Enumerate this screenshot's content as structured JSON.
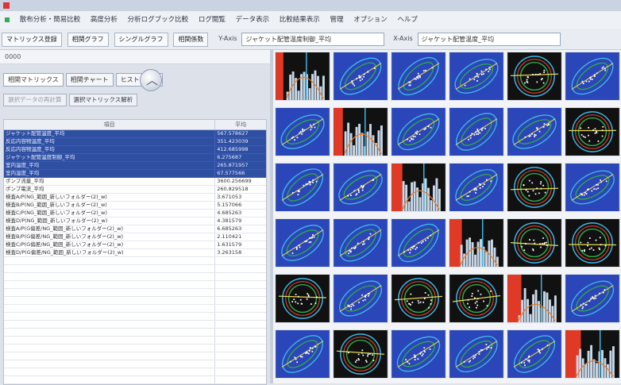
{
  "menu": {
    "items": [
      "散布分析・簡易比較",
      "高度分析",
      "分析ログブック比較",
      "ログ閲覧",
      "データ表示",
      "比較結果表示",
      "管理",
      "オプション",
      "ヘルプ"
    ]
  },
  "toolbar": {
    "tabs": [
      "マトリックス登録",
      "相関グラフ",
      "シングルグラフ",
      "相関係数"
    ],
    "yaxis_label": "Y-Axis",
    "yaxis_value": "ジャケット配管温度制御_平均",
    "xaxis_label": "X-Axis",
    "xaxis_value": "ジャケット配管温度_平均"
  },
  "subbar": {
    "text": "0000"
  },
  "left_tabs": [
    "相関マトリックス",
    "相関チャート",
    "ヒストグラム"
  ],
  "left_buttons": [
    "選択データの再計算",
    "選択マトリックス解析"
  ],
  "table": {
    "headers": [
      "項目",
      "平均"
    ],
    "rows": [
      {
        "name": "ジャケット配管温度_平均",
        "value": "567.578627",
        "selected": true
      },
      {
        "name": "反応内容物温度_平均",
        "value": "351.423039",
        "selected": true
      },
      {
        "name": "反応内容物温度_平均",
        "value": "412.685998",
        "selected": true
      },
      {
        "name": "ジャケット配管温度制御_平均",
        "value": "6.275687",
        "selected": true
      },
      {
        "name": "室内温度_平均",
        "value": "265.871957",
        "selected": true
      },
      {
        "name": "室内湿度_平均",
        "value": "67.577566",
        "selected": true
      },
      {
        "name": "ポンプ流量_平均",
        "value": "3600.256699",
        "selected": false
      },
      {
        "name": "ポンプ電流_平均",
        "value": "260.829518",
        "selected": false
      },
      {
        "name": "検査A/P(NG_範囲_新しいフォルダー(2)_w)",
        "value": "3.671053",
        "selected": false
      },
      {
        "name": "検査B/P(NG_範囲_新しいフォルダー(2)_w)",
        "value": "5.157066",
        "selected": false
      },
      {
        "name": "検査C/P(NG_範囲_新しいフォルダー(2)_w)",
        "value": "4.685263",
        "selected": false
      },
      {
        "name": "検査D/P(NG_範囲_新しいフォルダー(2)_w)",
        "value": "4.381579",
        "selected": false
      },
      {
        "name": "検査A/P(G偏差/NG_範囲_新しいフォルダー(2)_w)",
        "value": "6.685263",
        "selected": false
      },
      {
        "name": "検査B/P(G偏差/NG_範囲_新しいフォルダー(2)_w)",
        "value": "2.110421",
        "selected": false
      },
      {
        "name": "検査C/P(G偏差/NG_範囲_新しいフォルダー(2)_w)",
        "value": "1.631579",
        "selected": false
      },
      {
        "name": "検査D/P(G偏差/NG_範囲_新しいフォルダー(2)_w)",
        "value": "3.263158",
        "selected": false
      }
    ]
  },
  "matrix": {
    "rows": 6,
    "cols": 6,
    "cells": [
      [
        "histogram",
        "scatter-blue",
        "scatter-blue",
        "scatter-blue",
        "scatter-black",
        "scatter-blue"
      ],
      [
        "scatter-blue",
        "histogram",
        "scatter-blue",
        "scatter-blue",
        "scatter-blue",
        "scatter-black"
      ],
      [
        "scatter-blue",
        "scatter-blue",
        "histogram",
        "scatter-blue",
        "scatter-black",
        "scatter-blue"
      ],
      [
        "scatter-blue",
        "scatter-blue",
        "scatter-blue",
        "histogram",
        "scatter-black",
        "scatter-black"
      ],
      [
        "scatter-black",
        "scatter-blue",
        "scatter-black",
        "scatter-black",
        "histogram",
        "scatter-blue"
      ],
      [
        "scatter-blue",
        "scatter-black",
        "scatter-blue",
        "scatter-blue",
        "scatter-blue",
        "histogram"
      ]
    ],
    "colors": {
      "blue_bg": "#2b46b8",
      "black_bg": "#111111",
      "ellipse_inner": "#2fa84a",
      "ellipse_outer": "#3fb8e8",
      "regression": "#e8d84a",
      "red_band": "#e03a26",
      "bar": "#c8d8e8"
    }
  }
}
